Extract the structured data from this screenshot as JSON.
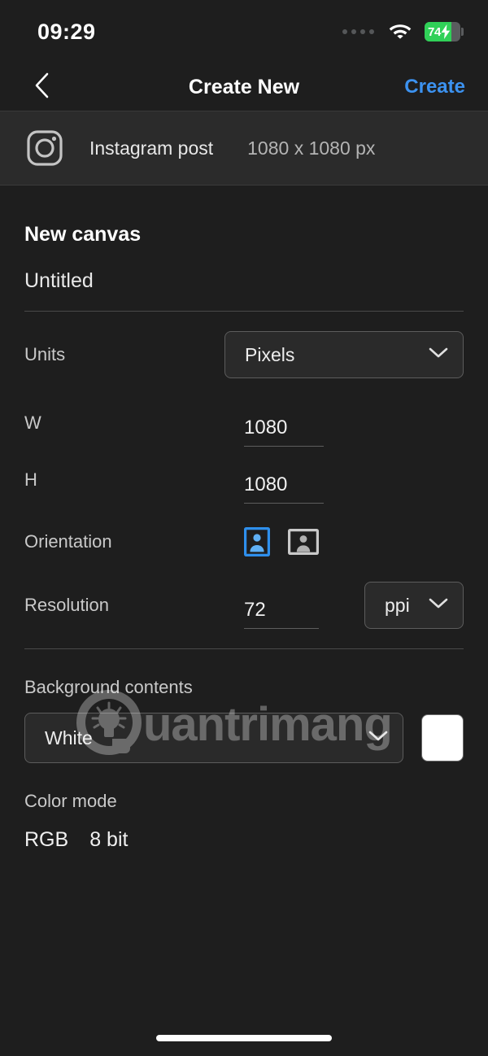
{
  "status_bar": {
    "time": "09:29",
    "battery_percent": "74",
    "battery_level": 74,
    "battery_charging": true,
    "battery_color": "#30d158",
    "wifi_icon": "wifi-icon",
    "signal_icon": "signal-dots-icon"
  },
  "nav": {
    "back_icon": "chevron-left-icon",
    "title": "Create New",
    "action_label": "Create",
    "action_color": "#3c92f0"
  },
  "preset": {
    "icon": "instagram-icon",
    "name": "Instagram post",
    "size": "1080 x 1080 px"
  },
  "form": {
    "section_title": "New canvas",
    "document_name": "Untitled",
    "units": {
      "label": "Units",
      "value": "Pixels",
      "chevron": "chevron-down-icon"
    },
    "width": {
      "label": "W",
      "value": "1080"
    },
    "height": {
      "label": "H",
      "value": "1080"
    },
    "orientation": {
      "label": "Orientation",
      "portrait_icon": "portrait-orientation-icon",
      "landscape_icon": "landscape-orientation-icon",
      "selected": "portrait",
      "selected_color": "#2e8fec"
    },
    "resolution": {
      "label": "Resolution",
      "value": "72",
      "unit": "ppi",
      "chevron": "chevron-down-icon"
    },
    "background": {
      "label": "Background contents",
      "value": "White",
      "chevron": "chevron-down-icon",
      "swatch_color": "#ffffff"
    },
    "color_mode": {
      "label": "Color mode",
      "mode": "RGB",
      "depth": "8 bit"
    }
  },
  "watermark": {
    "text": "uantrimang",
    "logo_icon": "quantrimang-lightbulb-logo"
  }
}
